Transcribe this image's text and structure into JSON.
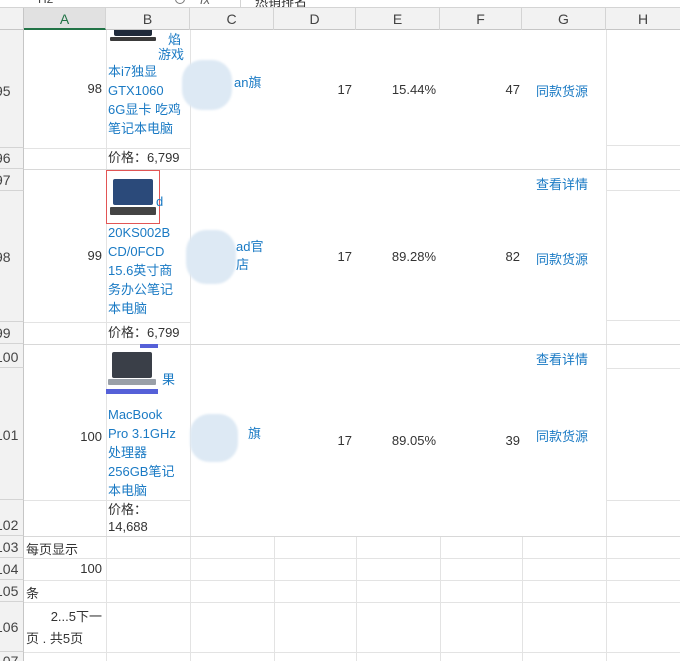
{
  "formula_bar": {
    "name_box": "H2",
    "fx_label": "fx",
    "value": "热销排名"
  },
  "columns": [
    "A",
    "B",
    "C",
    "D",
    "E",
    "F",
    "G",
    "H"
  ],
  "rows": {
    "r95": "95",
    "r96": "96",
    "r97": "97",
    "r98": "98",
    "r99": "99",
    "r100": "100",
    "r101": "101",
    "r102": "102",
    "r103": "103",
    "r104": "104",
    "r105": "105",
    "r106": "106",
    "r107": "107"
  },
  "products": [
    {
      "rank": "98",
      "title_lines": [
        "焰",
        "游戏",
        "本i7独显",
        "GTX1060",
        "6G显卡 吃鸡",
        "笔记本电脑"
      ],
      "price": "价格：6,799",
      "shop": "an旗",
      "d": "17",
      "percent": "15.44%",
      "f": "47",
      "action": "同款货源"
    },
    {
      "rank": "99",
      "title_lines": [
        "d",
        "20KS002B",
        "CD/0FCD",
        "15.6英寸商",
        "务办公笔记",
        "本电脑"
      ],
      "price": "价格：6,799",
      "shop_lines": [
        "ad官",
        "店"
      ],
      "d": "17",
      "percent": "89.28%",
      "f": "82",
      "detail": "查看详情",
      "action": "同款货源"
    },
    {
      "rank": "100",
      "title_lines": [
        "果",
        "MacBook",
        "Pro 3.1GHz",
        "处理器",
        "256GB笔记",
        "本电脑"
      ],
      "price_lines": [
        "价格：",
        "14,688"
      ],
      "shop": "旗",
      "d": "17",
      "percent": "89.05%",
      "f": "39",
      "detail": "查看详情",
      "action": "同款货源"
    }
  ],
  "footer": {
    "per_page_label": "每页显示",
    "per_page_value": "100",
    "unit": "条",
    "pager_lines": [
      "2...5下一",
      "页 . 共5页"
    ]
  }
}
